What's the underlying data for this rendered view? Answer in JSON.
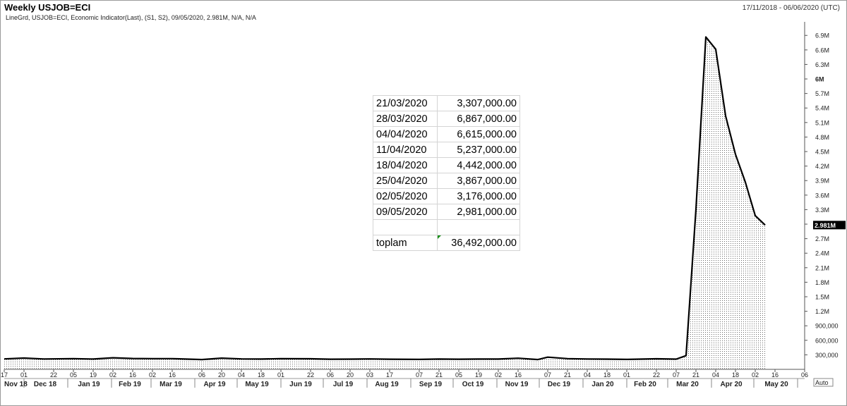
{
  "header": {
    "title": "Weekly USJOB=ECI",
    "date_range": "17/11/2018 - 06/06/2020 (UTC)",
    "subtitle": "LineGrd, USJOB=ECI, Economic Indicator(Last), (S1, S2), 09/05/2020, 2.981M, N/A, N/A"
  },
  "chart_data": {
    "type": "area",
    "x_start": "2018-11-17",
    "x_end": "2020-06-06",
    "ylim": [
      0,
      7200000
    ],
    "y_ticks": [
      {
        "value": 300000,
        "label": "300,000"
      },
      {
        "value": 600000,
        "label": "600,000"
      },
      {
        "value": 900000,
        "label": "900,000"
      },
      {
        "value": 1200000,
        "label": "1.2M"
      },
      {
        "value": 1500000,
        "label": "1.5M"
      },
      {
        "value": 1800000,
        "label": "1.8M"
      },
      {
        "value": 2100000,
        "label": "2.1M"
      },
      {
        "value": 2400000,
        "label": "2.4M"
      },
      {
        "value": 2700000,
        "label": "2.7M"
      },
      {
        "value": 3000000,
        "label": "2.981M",
        "highlight": true
      },
      {
        "value": 3300000,
        "label": "3.3M"
      },
      {
        "value": 3600000,
        "label": "3.6M"
      },
      {
        "value": 3900000,
        "label": "3.9M"
      },
      {
        "value": 4200000,
        "label": "4.2M"
      },
      {
        "value": 4500000,
        "label": "4.5M"
      },
      {
        "value": 4800000,
        "label": "4.8M"
      },
      {
        "value": 5100000,
        "label": "5.1M"
      },
      {
        "value": 5400000,
        "label": "5.4M"
      },
      {
        "value": 5700000,
        "label": "5.7M"
      },
      {
        "value": 6000000,
        "label": "6M",
        "bold": true
      },
      {
        "value": 6300000,
        "label": "6.3M"
      },
      {
        "value": 6600000,
        "label": "6.6M"
      },
      {
        "value": 6900000,
        "label": "6.9M"
      }
    ],
    "auto_label": "Auto",
    "last_value_label": "2.981M",
    "x_day_ticks": [
      {
        "date": "2018-11-17",
        "label": "17"
      },
      {
        "date": "2018-12-01",
        "label": "01"
      },
      {
        "date": "2018-12-22",
        "label": "22"
      },
      {
        "date": "2019-01-05",
        "label": "05"
      },
      {
        "date": "2019-01-19",
        "label": "19"
      },
      {
        "date": "2019-02-02",
        "label": "02"
      },
      {
        "date": "2019-02-16",
        "label": "16"
      },
      {
        "date": "2019-03-02",
        "label": "02"
      },
      {
        "date": "2019-03-16",
        "label": "16"
      },
      {
        "date": "2019-04-06",
        "label": "06"
      },
      {
        "date": "2019-04-20",
        "label": "20"
      },
      {
        "date": "2019-05-04",
        "label": "04"
      },
      {
        "date": "2019-05-18",
        "label": "18"
      },
      {
        "date": "2019-06-01",
        "label": "01"
      },
      {
        "date": "2019-06-22",
        "label": "22"
      },
      {
        "date": "2019-07-06",
        "label": "06"
      },
      {
        "date": "2019-07-20",
        "label": "20"
      },
      {
        "date": "2019-08-03",
        "label": "03"
      },
      {
        "date": "2019-08-17",
        "label": "17"
      },
      {
        "date": "2019-09-07",
        "label": "07"
      },
      {
        "date": "2019-09-21",
        "label": "21"
      },
      {
        "date": "2019-10-05",
        "label": "05"
      },
      {
        "date": "2019-10-19",
        "label": "19"
      },
      {
        "date": "2019-11-02",
        "label": "02"
      },
      {
        "date": "2019-11-16",
        "label": "16"
      },
      {
        "date": "2019-12-07",
        "label": "07"
      },
      {
        "date": "2019-12-21",
        "label": "21"
      },
      {
        "date": "2020-01-04",
        "label": "04"
      },
      {
        "date": "2020-01-18",
        "label": "18"
      },
      {
        "date": "2020-02-01",
        "label": "01"
      },
      {
        "date": "2020-02-22",
        "label": "22"
      },
      {
        "date": "2020-03-07",
        "label": "07"
      },
      {
        "date": "2020-03-21",
        "label": "21"
      },
      {
        "date": "2020-04-04",
        "label": "04"
      },
      {
        "date": "2020-04-18",
        "label": "18"
      },
      {
        "date": "2020-05-02",
        "label": "02"
      },
      {
        "date": "2020-05-16",
        "label": "16"
      },
      {
        "date": "2020-06-06",
        "label": "06"
      }
    ],
    "x_month_labels": [
      {
        "date": "2018-11-24",
        "label": "Nov 18"
      },
      {
        "date": "2018-12-16",
        "label": "Dec 18"
      },
      {
        "date": "2019-01-16",
        "label": "Jan 19"
      },
      {
        "date": "2019-02-14",
        "label": "Feb 19"
      },
      {
        "date": "2019-03-15",
        "label": "Mar 19"
      },
      {
        "date": "2019-04-15",
        "label": "Apr 19"
      },
      {
        "date": "2019-05-15",
        "label": "May 19"
      },
      {
        "date": "2019-06-15",
        "label": "Jun 19"
      },
      {
        "date": "2019-07-15",
        "label": "Jul 19"
      },
      {
        "date": "2019-08-15",
        "label": "Aug 19"
      },
      {
        "date": "2019-09-15",
        "label": "Sep 19"
      },
      {
        "date": "2019-10-15",
        "label": "Oct 19"
      },
      {
        "date": "2019-11-15",
        "label": "Nov 19"
      },
      {
        "date": "2019-12-15",
        "label": "Dec 19"
      },
      {
        "date": "2020-01-15",
        "label": "Jan 20"
      },
      {
        "date": "2020-02-14",
        "label": "Feb 20"
      },
      {
        "date": "2020-03-15",
        "label": "Mar 20"
      },
      {
        "date": "2020-04-15",
        "label": "Apr 20"
      },
      {
        "date": "2020-05-17",
        "label": "May 20"
      }
    ],
    "series": [
      {
        "points": [
          [
            "2018-11-17",
            216000
          ],
          [
            "2018-12-01",
            233000
          ],
          [
            "2018-12-15",
            214000
          ],
          [
            "2019-01-05",
            221000
          ],
          [
            "2019-01-19",
            213000
          ],
          [
            "2019-02-02",
            239000
          ],
          [
            "2019-02-16",
            225000
          ],
          [
            "2019-03-02",
            222000
          ],
          [
            "2019-03-16",
            221000
          ],
          [
            "2019-04-06",
            202000
          ],
          [
            "2019-04-20",
            231000
          ],
          [
            "2019-05-04",
            216000
          ],
          [
            "2019-05-18",
            212000
          ],
          [
            "2019-06-01",
            222000
          ],
          [
            "2019-06-22",
            218000
          ],
          [
            "2019-07-06",
            209000
          ],
          [
            "2019-07-20",
            211000
          ],
          [
            "2019-08-03",
            216000
          ],
          [
            "2019-08-17",
            210000
          ],
          [
            "2019-09-07",
            206000
          ],
          [
            "2019-09-21",
            212000
          ],
          [
            "2019-10-05",
            210000
          ],
          [
            "2019-10-19",
            212000
          ],
          [
            "2019-11-02",
            213000
          ],
          [
            "2019-11-16",
            230000
          ],
          [
            "2019-11-30",
            203000
          ],
          [
            "2019-12-07",
            252000
          ],
          [
            "2019-12-21",
            222000
          ],
          [
            "2020-01-04",
            214000
          ],
          [
            "2020-01-18",
            211000
          ],
          [
            "2020-02-01",
            205000
          ],
          [
            "2020-02-22",
            219000
          ],
          [
            "2020-03-07",
            211000
          ],
          [
            "2020-03-14",
            282000
          ],
          [
            "2020-03-21",
            3307000
          ],
          [
            "2020-03-28",
            6867000
          ],
          [
            "2020-04-04",
            6615000
          ],
          [
            "2020-04-11",
            5237000
          ],
          [
            "2020-04-18",
            4442000
          ],
          [
            "2020-04-25",
            3867000
          ],
          [
            "2020-05-02",
            3176000
          ],
          [
            "2020-05-09",
            2981000
          ]
        ]
      }
    ]
  },
  "sheet": {
    "rows": [
      {
        "date": "21/03/2020",
        "value": "3,307,000.00"
      },
      {
        "date": "28/03/2020",
        "value": "6,867,000.00"
      },
      {
        "date": "04/04/2020",
        "value": "6,615,000.00"
      },
      {
        "date": "11/04/2020",
        "value": "5,237,000.00"
      },
      {
        "date": "18/04/2020",
        "value": "4,442,000.00"
      },
      {
        "date": "25/04/2020",
        "value": "3,867,000.00"
      },
      {
        "date": "02/05/2020",
        "value": "3,176,000.00"
      },
      {
        "date": "09/05/2020",
        "value": "2,981,000.00"
      }
    ],
    "total_label": "toplam",
    "total_value": "36,492,000.00"
  }
}
